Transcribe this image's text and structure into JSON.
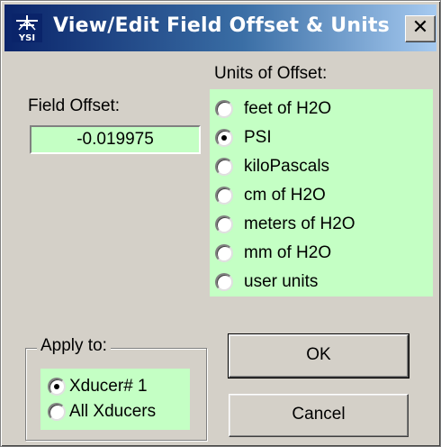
{
  "window": {
    "title": "View/Edit Field Offset & Units",
    "icon": "ysi-app-icon",
    "icon_text": "YSI",
    "close_label": "✕"
  },
  "field_offset": {
    "label": "Field Offset:",
    "value": "-0.019975"
  },
  "units": {
    "label": "Units of Offset:",
    "options": [
      {
        "label": "feet of H2O",
        "selected": false
      },
      {
        "label": "PSI",
        "selected": true
      },
      {
        "label": "kiloPascals",
        "selected": false
      },
      {
        "label": "cm of H2O",
        "selected": false
      },
      {
        "label": "meters of H2O",
        "selected": false
      },
      {
        "label": "mm of H2O",
        "selected": false
      },
      {
        "label": "user units",
        "selected": false
      }
    ]
  },
  "apply_to": {
    "label": "Apply to:",
    "options": [
      {
        "label": "Xducer# 1",
        "selected": true
      },
      {
        "label": "All Xducers",
        "selected": false
      }
    ]
  },
  "buttons": {
    "ok": "OK",
    "cancel": "Cancel"
  },
  "colors": {
    "titlebar_start": "#0a246a",
    "titlebar_end": "#a6caf0",
    "panel_green": "#c4ffc4",
    "face": "#d4d0c8"
  }
}
